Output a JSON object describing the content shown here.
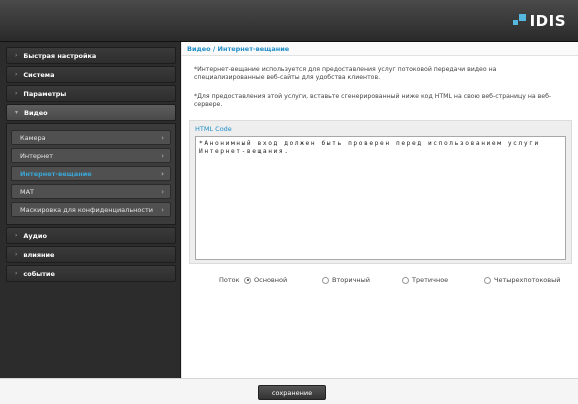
{
  "brand": {
    "logo_text": "IDIS"
  },
  "sidebar": {
    "items_top": [
      {
        "label": "Быстрая настройка"
      },
      {
        "label": "Система"
      },
      {
        "label": "Параметры"
      },
      {
        "label": "Видео"
      }
    ],
    "video_submenu": [
      {
        "label": "Камера"
      },
      {
        "label": "Интернет"
      },
      {
        "label": "Интернет-вещание"
      },
      {
        "label": "МАТ"
      },
      {
        "label": "Маскировка для конфиденциальности"
      }
    ],
    "items_bottom": [
      {
        "label": "Аудио"
      },
      {
        "label": "влияние"
      },
      {
        "label": "событие"
      }
    ]
  },
  "content": {
    "title": "Видео / Интернет-вещание",
    "description_1": "*Интернет-вещание используется для предоставления услуг потоковой передачи видео на специализированные веб-сайты для удобства клиентов.",
    "description_2": "*Для предоставления этой услуги, вставьте сгенерированный ниже код HTML на свою веб-страницу на веб-сервере.",
    "code_label": "HTML Code",
    "code_text": "*Анонимный вход должен быть проверен перед использованием услуги Интернет-вещания."
  },
  "stream": {
    "label": "Поток",
    "options": [
      {
        "label": "Основной",
        "selected": true
      },
      {
        "label": "Вторичный",
        "selected": false
      },
      {
        "label": "Третичное",
        "selected": false
      },
      {
        "label": "Четырехпотоковый",
        "selected": false
      }
    ]
  },
  "footer": {
    "save_label": "сохранение"
  },
  "colors": {
    "accent": "#1f8dc6",
    "active_menu": "#3aa8d8",
    "sidebar_bg": "#2c2c2c"
  }
}
